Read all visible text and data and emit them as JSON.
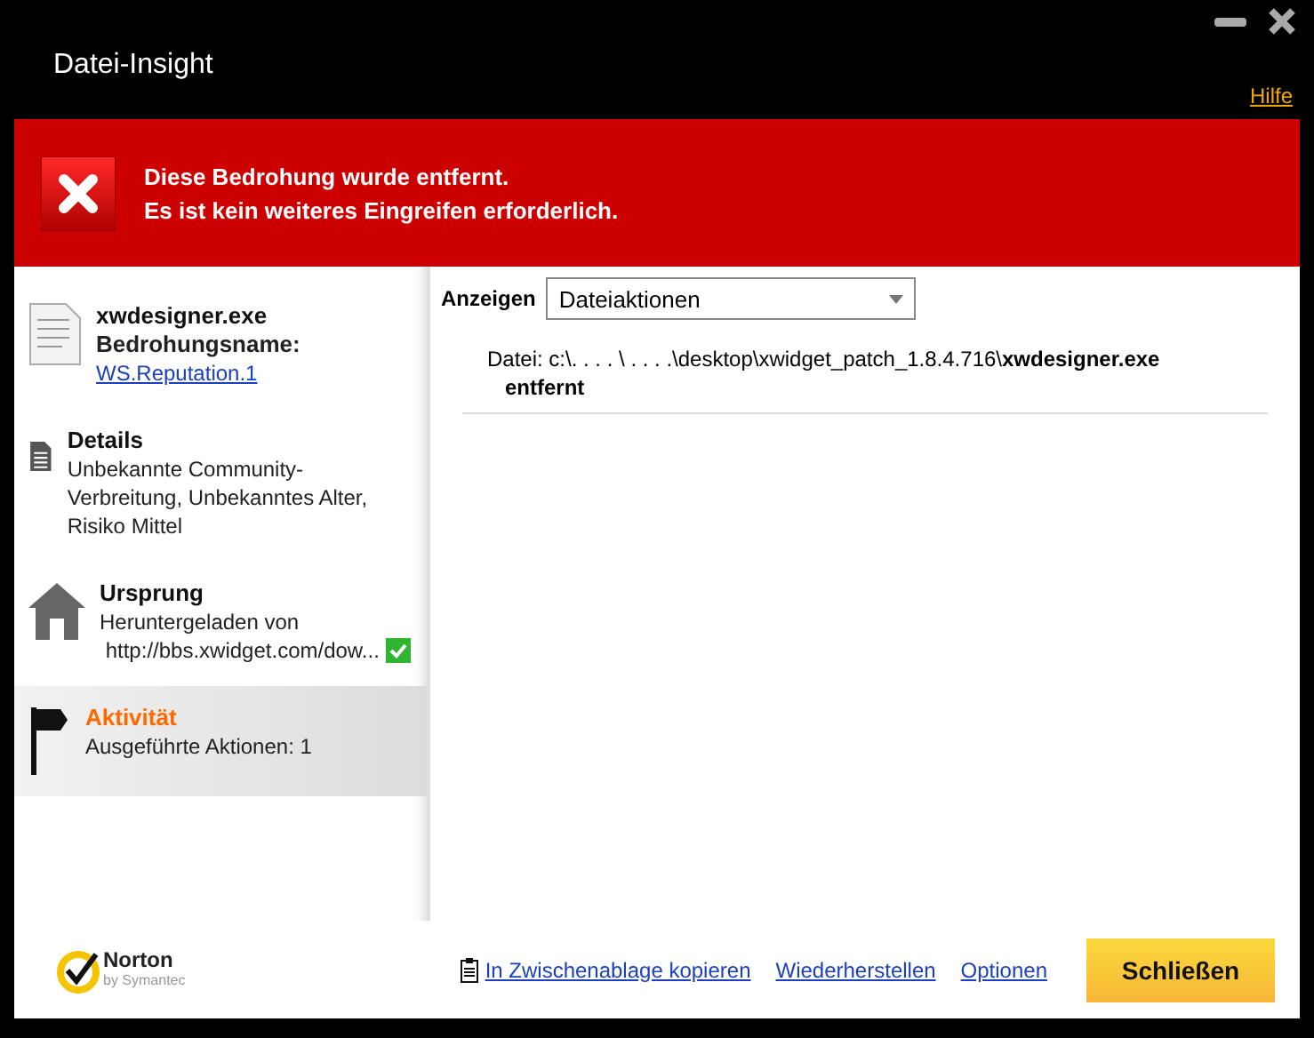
{
  "window": {
    "title": "Datei-Insight",
    "help_link": "Hilfe"
  },
  "banner": {
    "lines": [
      "Diese Bedrohung wurde entfernt.",
      "Es ist kein weiteres Eingreifen erforderlich."
    ]
  },
  "sidebar": {
    "items": [
      {
        "kind": "file",
        "selected": false,
        "title": "xwdesigner.exe",
        "subtitle": "Bedrohungsname:",
        "link": "WS.Reputation.1"
      },
      {
        "kind": "details",
        "selected": false,
        "title": "Details",
        "text": "Unbekannte Community-Verbreitung,  Unbekanntes Alter,  Risiko Mittel"
      },
      {
        "kind": "origin",
        "selected": false,
        "title": "Ursprung",
        "text": "Heruntergeladen von",
        "url": "http://bbs.xwidget.com/dow...",
        "verified": true
      },
      {
        "kind": "activity",
        "selected": true,
        "title": "Aktivität",
        "text": "Ausgeführte Aktionen: 1"
      }
    ]
  },
  "content": {
    "show_label": "Anzeigen",
    "show_select": "Dateiaktionen",
    "actions": [
      {
        "file": "Datei: c:\\. . . . \\ . . . .\\desktop\\xwidget_patch_1.8.4.716\\**xwdesigner.exe**",
        "result": "entfernt"
      }
    ]
  },
  "footer": {
    "brand": "Norton",
    "brand_byline": "by Symantec",
    "links": [
      "In Zwischenablage kopieren",
      "Wiederherstellen",
      "Optionen"
    ],
    "close_button": "Schließen"
  }
}
